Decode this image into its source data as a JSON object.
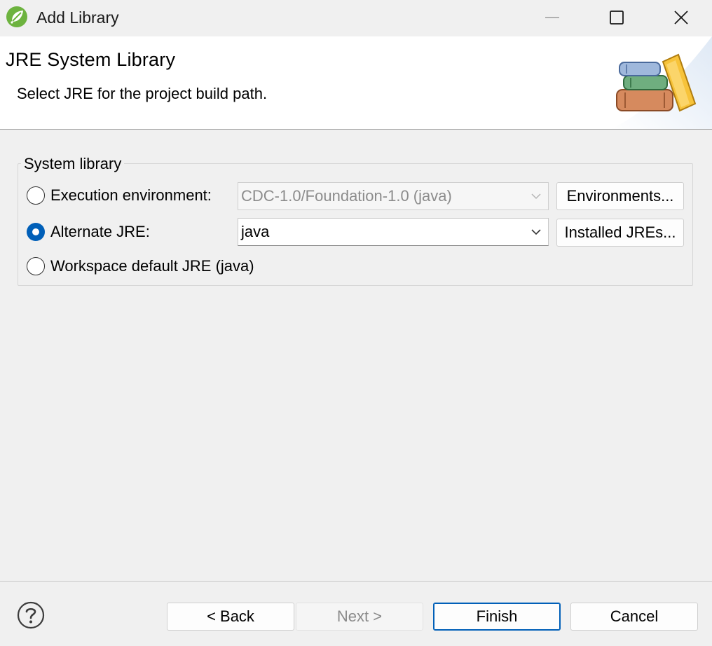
{
  "window": {
    "title": "Add Library",
    "app_icon": "spring-leaf-icon",
    "controls": [
      "minimize-icon",
      "maximize-icon",
      "close-icon"
    ]
  },
  "header": {
    "title": "JRE System Library",
    "description": "Select JRE for the project build path.",
    "image": "library-books-icon"
  },
  "group": {
    "legend": "System library",
    "options": [
      {
        "label": "Execution environment:",
        "checked": false,
        "combo_value": "CDC-1.0/Foundation-1.0 (java)",
        "combo_enabled": false,
        "button": "Environments..."
      },
      {
        "label": "Alternate JRE:",
        "checked": true,
        "combo_value": "java",
        "combo_enabled": true,
        "button": "Installed JREs..."
      },
      {
        "label": "Workspace default JRE (java)",
        "checked": false
      }
    ]
  },
  "footer": {
    "help_icon": "help-question-icon",
    "back": "< Back",
    "next": "Next >",
    "finish": "Finish",
    "cancel": "Cancel"
  },
  "colors": {
    "accent": "#005fb8",
    "background": "#f0f0f0",
    "banner": "#ffffff"
  }
}
